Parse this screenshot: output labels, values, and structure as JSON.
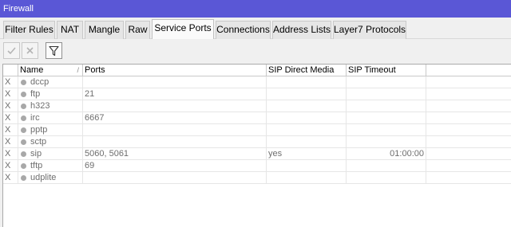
{
  "window": {
    "title": "Firewall"
  },
  "tabs": [
    {
      "label": "Filter Rules"
    },
    {
      "label": "NAT"
    },
    {
      "label": "Mangle"
    },
    {
      "label": "Raw"
    },
    {
      "label": "Service Ports",
      "active": true
    },
    {
      "label": "Connections"
    },
    {
      "label": "Address Lists"
    },
    {
      "label": "Layer7 Protocols"
    }
  ],
  "toolbar": {
    "enable_icon": "check-icon",
    "disable_icon": "x-icon",
    "filter_icon": "filter-icon"
  },
  "table": {
    "columns": {
      "flag": "",
      "name": "Name",
      "ports": "Ports",
      "sip_direct_media": "SIP Direct Media",
      "sip_timeout": "SIP Timeout"
    },
    "rows": [
      {
        "flag": "X",
        "name": "dccp",
        "ports": "",
        "sip_direct_media": "",
        "sip_timeout": ""
      },
      {
        "flag": "X",
        "name": "ftp",
        "ports": "21",
        "sip_direct_media": "",
        "sip_timeout": ""
      },
      {
        "flag": "X",
        "name": "h323",
        "ports": "",
        "sip_direct_media": "",
        "sip_timeout": ""
      },
      {
        "flag": "X",
        "name": "irc",
        "ports": "6667",
        "sip_direct_media": "",
        "sip_timeout": ""
      },
      {
        "flag": "X",
        "name": "pptp",
        "ports": "",
        "sip_direct_media": "",
        "sip_timeout": ""
      },
      {
        "flag": "X",
        "name": "sctp",
        "ports": "",
        "sip_direct_media": "",
        "sip_timeout": ""
      },
      {
        "flag": "X",
        "name": "sip",
        "ports": "5060, 5061",
        "sip_direct_media": "yes",
        "sip_timeout": "01:00:00"
      },
      {
        "flag": "X",
        "name": "tftp",
        "ports": "69",
        "sip_direct_media": "",
        "sip_timeout": ""
      },
      {
        "flag": "X",
        "name": "udplite",
        "ports": "",
        "sip_direct_media": "",
        "sip_timeout": ""
      }
    ]
  },
  "colors": {
    "titlebar": "#5a57d6",
    "disabled_text": "#6e6e6e",
    "status_dot": "#a8a8a8"
  }
}
